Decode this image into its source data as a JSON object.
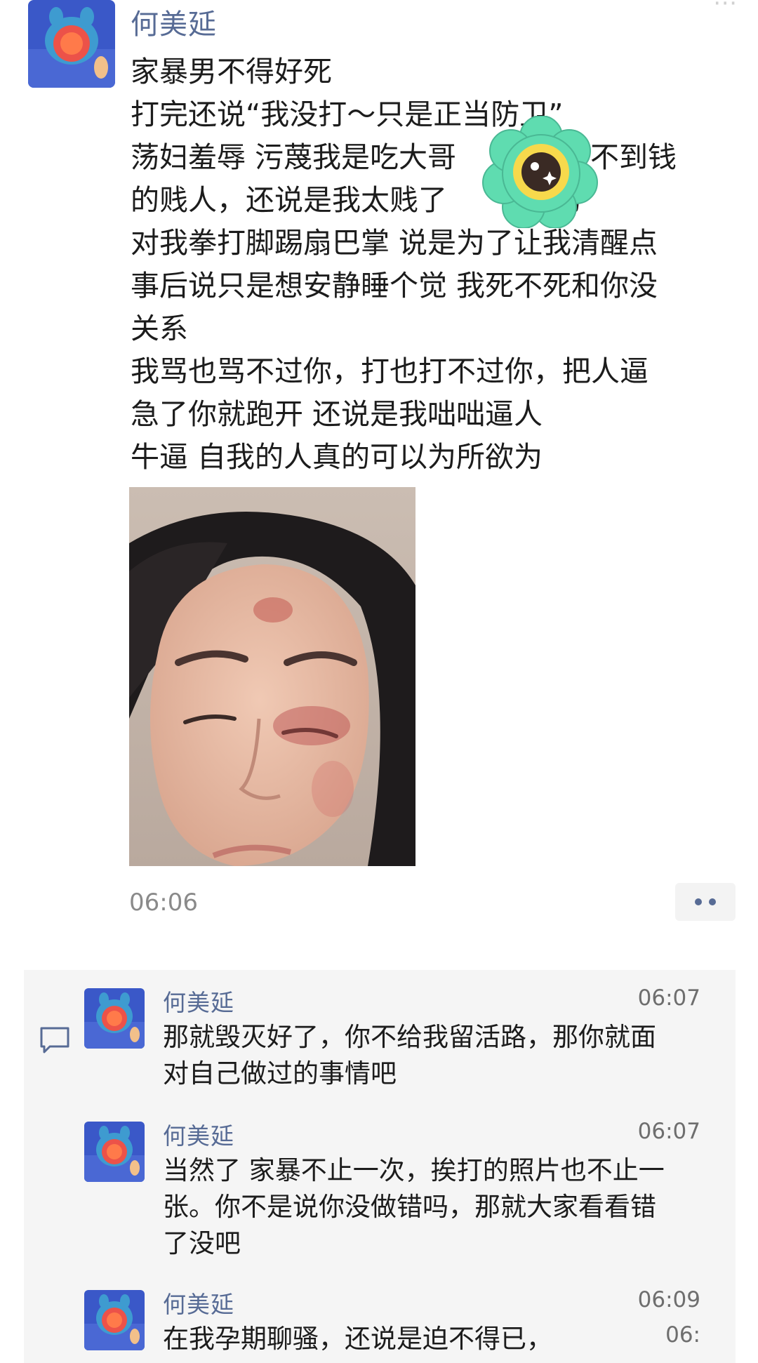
{
  "post": {
    "author": "何美延",
    "top_right_icon": "more-dots-icon",
    "lines": [
      "家暴男不得好死",
      "打完还说“我没打～只是正当防卫”",
      "荡妇羞辱 污蔑我是吃大哥",
      "的贱人，还说是我太贱了",
      "对我拳打脚踢扇巴掌 说是为了让我清醒点",
      "事后说只是想安静睡个觉 我死不死和你没",
      "关系",
      "我骂也骂不过你，打也打不过你，把人逼",
      "急了你就跑开 还说是我咄咄逼人",
      "牛逼 自我的人真的可以为所欲为"
    ],
    "line3_tail": "赚不到钱",
    "line4_tail": "骂",
    "time": "06:06",
    "more_button": "more-actions-button"
  },
  "comments": [
    {
      "name": "何美延",
      "time": "06:07",
      "lines": [
        "那就毁灭好了，你不给我留活路，那你就面",
        "对自己做过的事情吧"
      ]
    },
    {
      "name": "何美延",
      "time": "06:07",
      "lines": [
        "当然了 家暴不止一次，挨打的照片也不止一",
        "张。你不是说你没做错吗，那就大家看看错",
        "了没吧"
      ]
    },
    {
      "name": "何美延",
      "time": "06:09",
      "time2": "06:",
      "lines": [
        "在我孕期聊骚，还说是迫不得已，"
      ]
    }
  ],
  "colors": {
    "name_blue": "#576b95",
    "comment_bg": "#f5f5f5",
    "sticker_green": "#5fdcb0",
    "sticker_yellow": "#f7d94c"
  }
}
